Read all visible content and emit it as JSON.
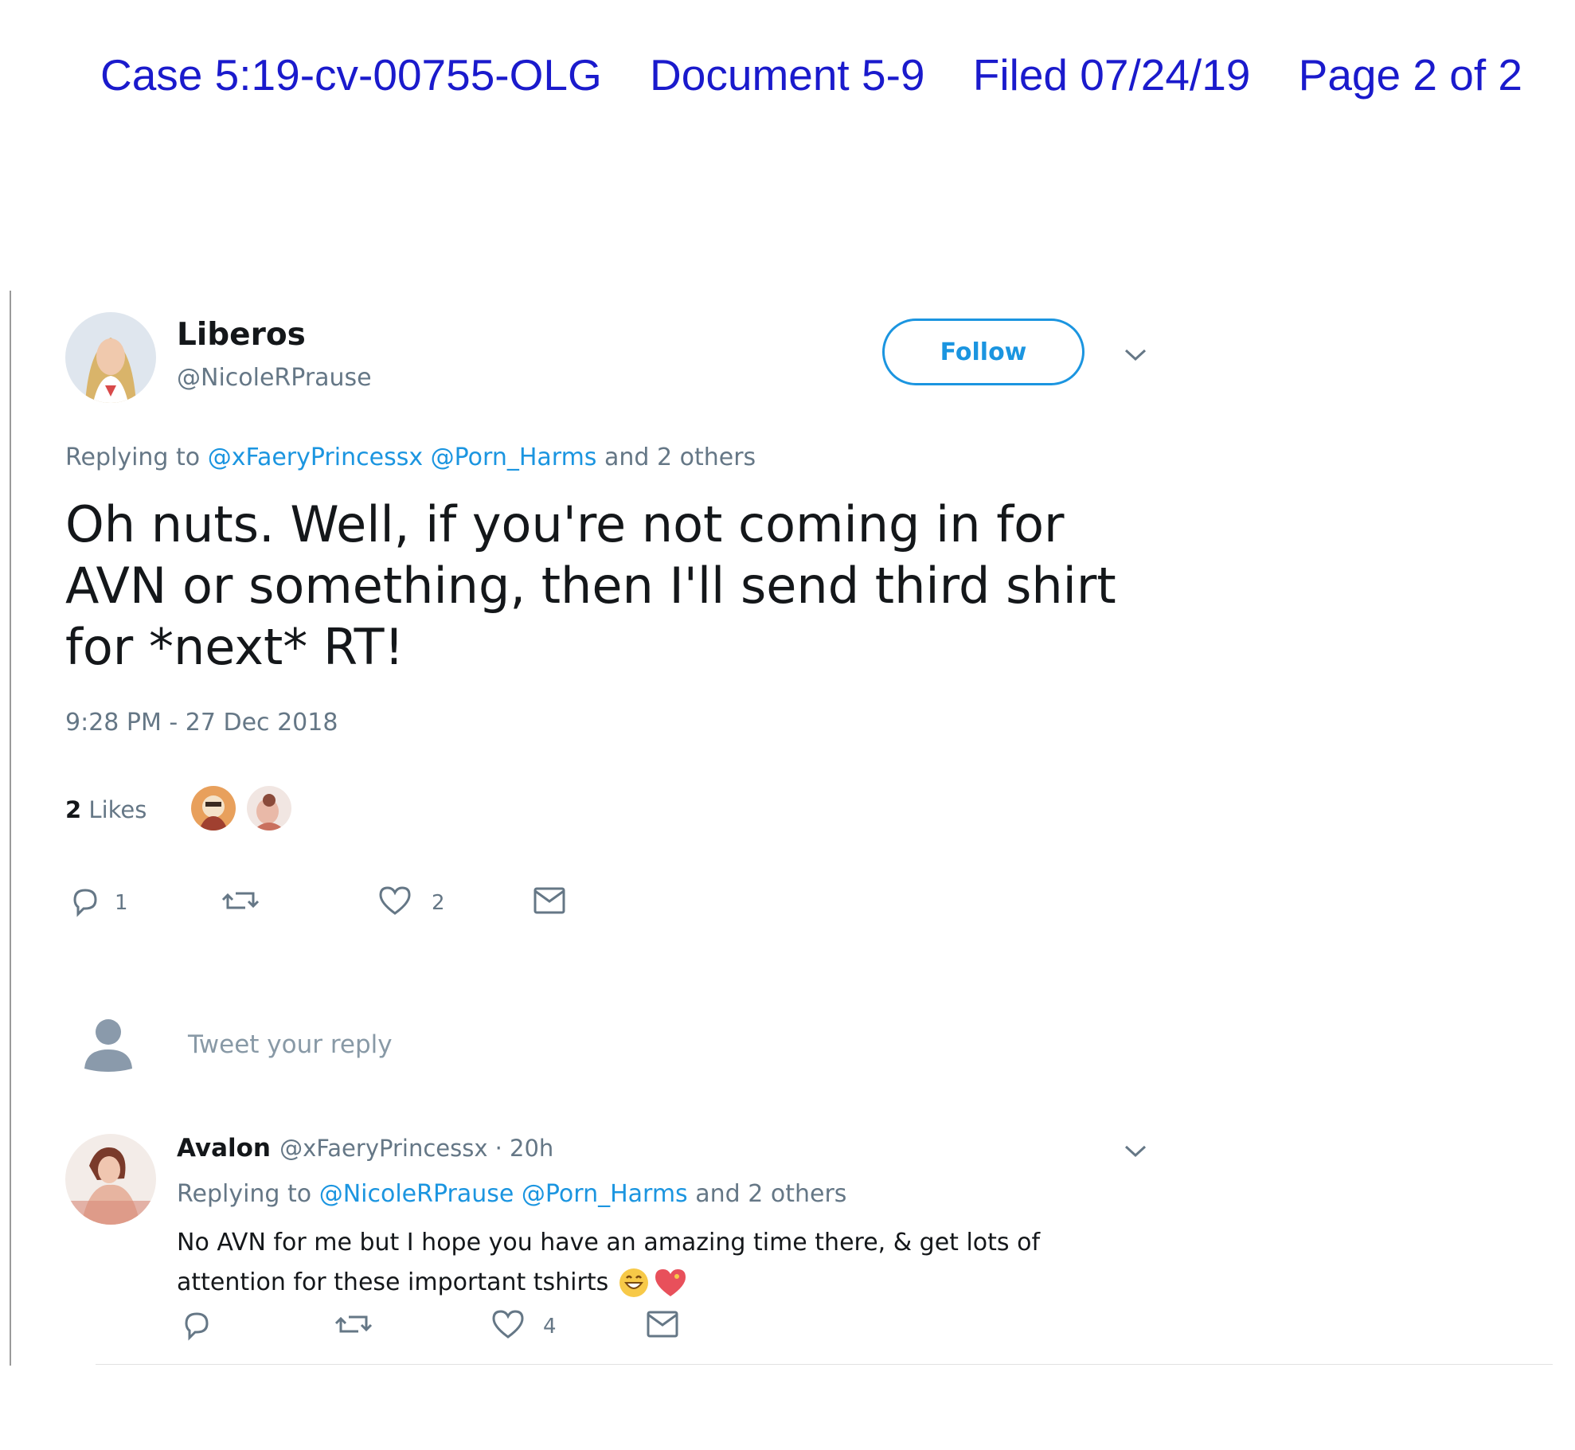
{
  "doc_header": {
    "case": "Case 5:19-cv-00755-OLG",
    "document": "Document 5-9",
    "filed": "Filed 07/24/19",
    "page": "Page 2 of 2"
  },
  "tweet": {
    "author_name": "Liberos",
    "author_handle": "@NicoleRPrause",
    "follow_label": "Follow",
    "replying_prefix": "Replying to",
    "mentions": [
      "@xFaeryPrincessx",
      "@Porn_Harms"
    ],
    "others": "and 2 others",
    "text": "Oh nuts. Well, if you're not coming in for AVN or something, then I'll send third shirt for *next* RT!",
    "timestamp": "9:28 PM - 27 Dec 2018",
    "likes_count": "2",
    "likes_word": "Likes",
    "reply_count": "1",
    "like_count": "2"
  },
  "composer": {
    "placeholder": "Tweet your reply"
  },
  "reply": {
    "author_name": "Avalon",
    "author_handle": "@xFaeryPrincessx",
    "time": "· 20h",
    "replying_prefix": "Replying to",
    "mentions": [
      "@NicoleRPrause",
      "@Porn_Harms"
    ],
    "others": "and 2 others",
    "text_line1": "No AVN for me  but I hope you have an amazing time there, & get lots of",
    "text_line2": "attention for these important tshirts",
    "like_count": "4"
  },
  "colors": {
    "header_blue": "#1a1acc",
    "twitter_blue": "#1b95e0",
    "muted_gray": "#657786"
  },
  "icons": [
    "chevron-down-icon",
    "reply-icon",
    "retweet-icon",
    "heart-icon",
    "envelope-icon",
    "grinning-emoji-icon",
    "heart-emoji-icon",
    "default-avatar-icon"
  ]
}
